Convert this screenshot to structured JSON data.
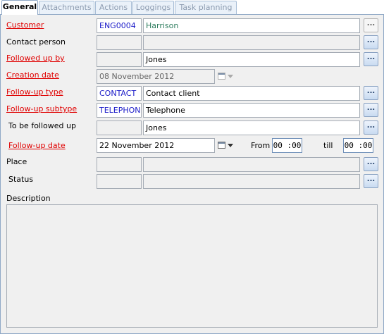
{
  "tabs": [
    "General",
    "Attachments",
    "Actions",
    "Loggings",
    "Task planning"
  ],
  "fields": {
    "customer": {
      "label": "Customer",
      "code": "ENG0004",
      "value": "Harrison"
    },
    "contact_person": {
      "label": "Contact person",
      "code": "",
      "value": ""
    },
    "followed_up_by": {
      "label": "Followed up by",
      "code": "",
      "value": "Jones"
    },
    "creation_date": {
      "label": "Creation date",
      "value": "08 November 2012"
    },
    "followup_type": {
      "label": "Follow-up type",
      "code": "CONTACT",
      "value": "Contact client"
    },
    "followup_subtype": {
      "label": "Follow-up subtype",
      "code": "TELEPHON",
      "value": "Telephone"
    },
    "to_be_followed_up": {
      "label": "To be followed up",
      "code": "",
      "value": "Jones"
    },
    "followup_date": {
      "label": "Follow-up date",
      "value": "22 November 2012",
      "from_label": "From",
      "from_time": "00 :00",
      "till_label": "till",
      "till_time": "00 :00"
    },
    "place": {
      "label": "Place",
      "code": "",
      "value": ""
    },
    "status": {
      "label": "Status",
      "code": "",
      "value": ""
    },
    "description": {
      "label": "Description",
      "value": ""
    }
  },
  "buttons": {
    "lookup": "..."
  },
  "colors": {
    "required_label": "#e00000",
    "code_text": "#1a1ac8",
    "customer_name": "#2e7d5e",
    "tab_border": "#8fa8c6"
  }
}
